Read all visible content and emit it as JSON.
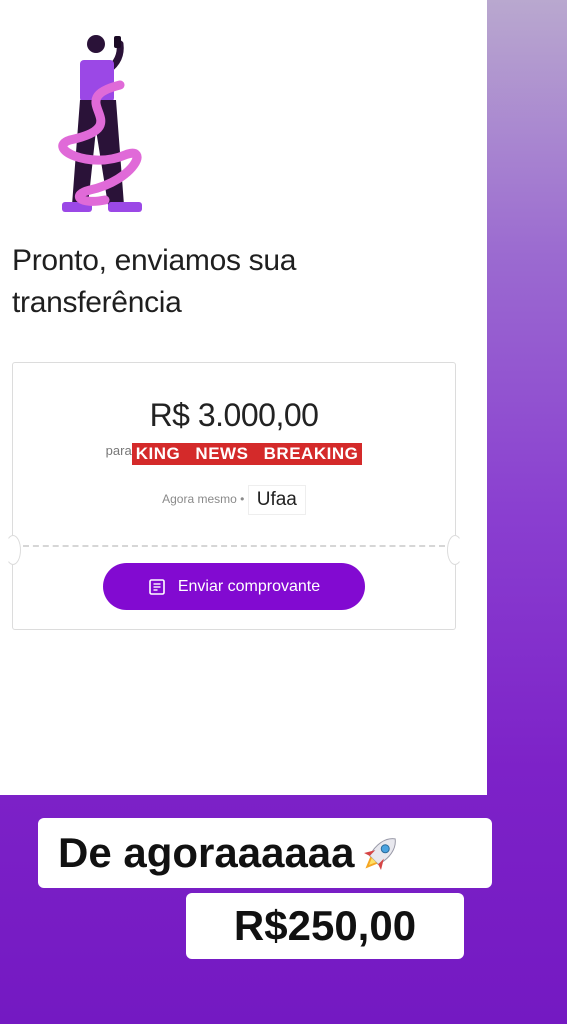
{
  "confirmation": {
    "title": "Pronto, enviamos sua transferência"
  },
  "receipt": {
    "amount": "R$ 3.000,00",
    "recipient_prefix": "para",
    "recipient_name": "KING NEWS BREAKING",
    "time_label": "Agora mesmo",
    "separator": "•",
    "tag": "Ufaa",
    "send_button_label": "Enviar comprovante"
  },
  "overlay": {
    "caption_line1": "De agoraaaaaa",
    "caption_line2": "R$250,00"
  },
  "icons": {
    "illustration": "person-with-phone-illustration",
    "button_icon": "receipt-doc-icon",
    "emoji": "rocket-icon"
  },
  "colors": {
    "brand_purple": "#820ad1",
    "recipient_highlight": "#d42a2a",
    "background_gradient_end": "#7419c2"
  }
}
